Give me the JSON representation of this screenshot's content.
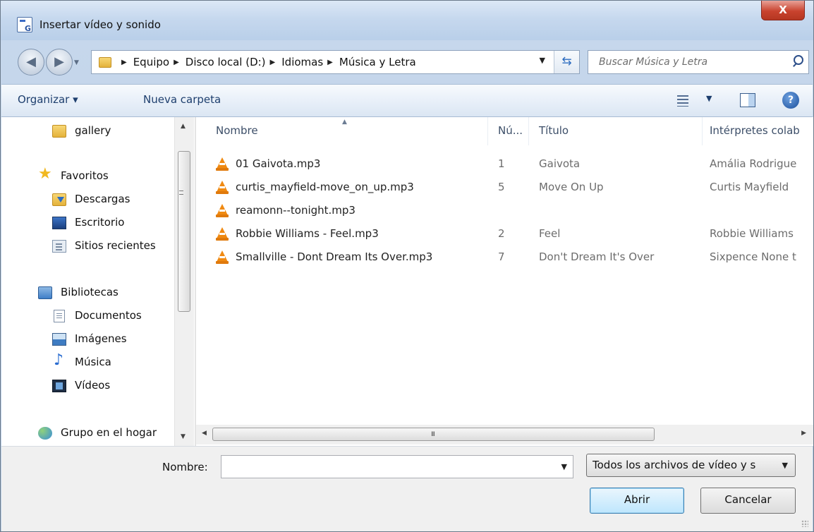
{
  "window": {
    "title": "Insertar vídeo y sonido",
    "close_label": "X"
  },
  "address": {
    "crumbs": [
      "Equipo",
      "Disco local (D:)",
      "Idiomas",
      "Música y Letra"
    ]
  },
  "search": {
    "placeholder": "Buscar Música y Letra"
  },
  "toolbar": {
    "organize_label": "Organizar ▾",
    "new_folder_label": "Nueva carpeta"
  },
  "sidebar": {
    "items": [
      {
        "label": "gallery",
        "icon": "folder-icon"
      },
      {
        "label": "Favoritos",
        "icon": "star-icon"
      },
      {
        "label": "Descargas",
        "icon": "downloads-folder-icon"
      },
      {
        "label": "Escritorio",
        "icon": "desktop-icon"
      },
      {
        "label": "Sitios recientes",
        "icon": "recent-places-icon"
      },
      {
        "label": "Bibliotecas",
        "icon": "libraries-icon"
      },
      {
        "label": "Documentos",
        "icon": "documents-icon"
      },
      {
        "label": "Imágenes",
        "icon": "pictures-icon"
      },
      {
        "label": "Música",
        "icon": "music-note-icon"
      },
      {
        "label": "Vídeos",
        "icon": "videos-icon"
      },
      {
        "label": "Grupo en el hogar",
        "icon": "homegroup-icon"
      }
    ]
  },
  "files": {
    "columns": [
      "Nombre",
      "Nú...",
      "Título",
      "Intérpretes colab"
    ],
    "rows": [
      {
        "name": "01 Gaivota.mp3",
        "num": "1",
        "title": "Gaivota",
        "artist": "Amália Rodrigue"
      },
      {
        "name": "curtis_mayfield-move_on_up.mp3",
        "num": "5",
        "title": "Move On Up",
        "artist": "Curtis Mayfield"
      },
      {
        "name": "reamonn--tonight.mp3",
        "num": "",
        "title": "",
        "artist": ""
      },
      {
        "name": "Robbie Williams - Feel.mp3",
        "num": "2",
        "title": "Feel",
        "artist": "Robbie Williams"
      },
      {
        "name": "Smallville - Dont Dream Its Over.mp3",
        "num": "7",
        "title": "Don't Dream It's Over",
        "artist": "Sixpence None t"
      }
    ]
  },
  "footer": {
    "name_label": "Nombre:",
    "name_value": "",
    "filetype_value": "Todos los archivos de vídeo y s",
    "open_label": "Abrir",
    "cancel_label": "Cancelar"
  },
  "colors": {
    "accent": "#3c7fb1",
    "titlebar": "#c6d8ee",
    "close": "#c9432e",
    "vlc": "#f08a12"
  }
}
